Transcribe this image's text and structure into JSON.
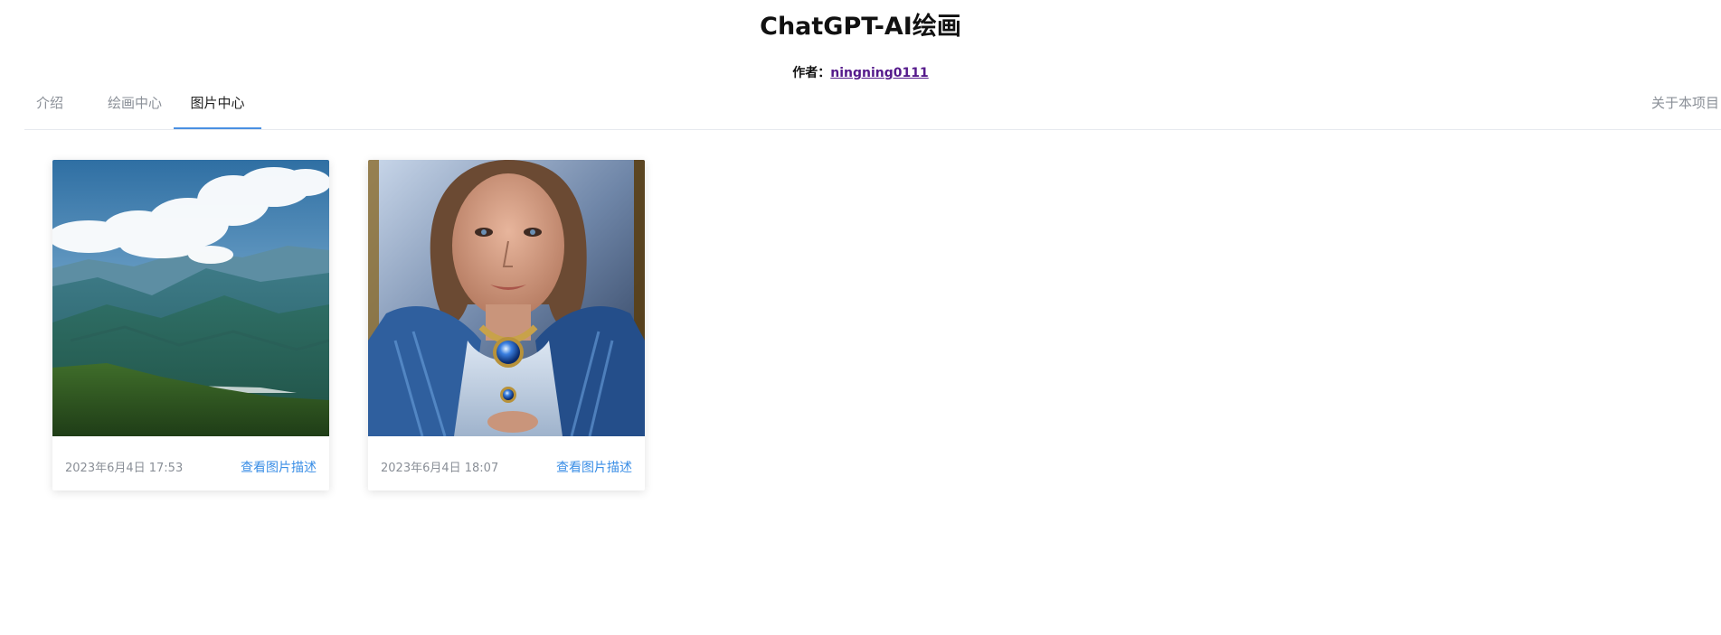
{
  "header": {
    "title": "ChatGPT-AI绘画",
    "author_prefix": "作者：",
    "author_name": "ningning0111"
  },
  "tabs": [
    {
      "label": "介绍",
      "active": false
    },
    {
      "label": "绘画中心",
      "active": false
    },
    {
      "label": "图片中心",
      "active": true
    }
  ],
  "tab_right": {
    "label": "关于本项目"
  },
  "colors": {
    "accent": "#4a90e2",
    "link": "#3a8ee6",
    "author_link": "#551a8b",
    "muted": "#8a8f97"
  },
  "cards": [
    {
      "image": "mountain-landscape-image",
      "date": "2023年6月4日 17:53",
      "link_label": "查看图片描述"
    },
    {
      "image": "fantasy-woman-portrait-image",
      "date": "2023年6月4日 18:07",
      "link_label": "查看图片描述"
    }
  ]
}
